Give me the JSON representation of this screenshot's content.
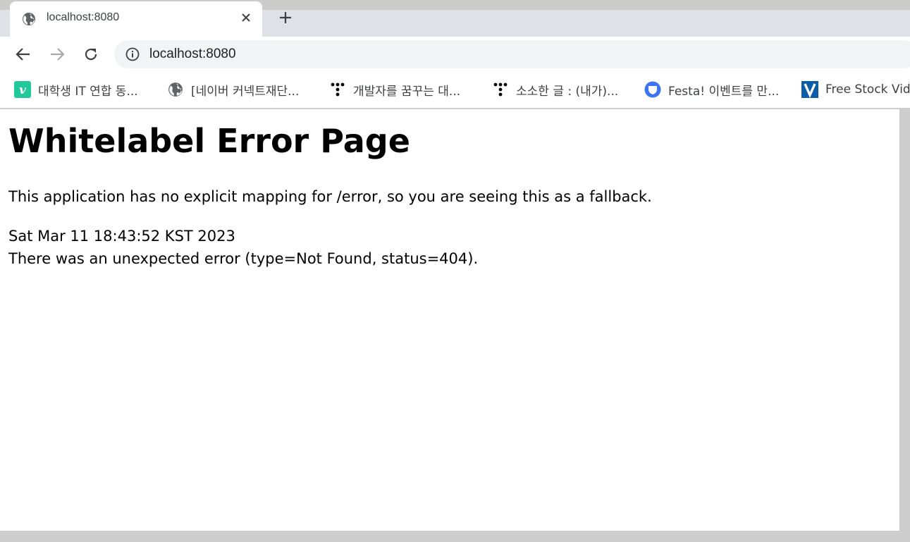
{
  "browser": {
    "tab": {
      "title": "localhost:8080",
      "close_glyph": "✕"
    },
    "new_tab_glyph": "+",
    "address_bar": {
      "value": "localhost:8080"
    },
    "bookmarks": [
      {
        "label": "대학생 IT 연합 동...",
        "icon": "v-letter-icon",
        "icon_text": "v",
        "icon_color": "#20c997"
      },
      {
        "label": "[네이버 커넥트재단...",
        "icon": "globe-icon"
      },
      {
        "label": "개발자를 꿈꾸는 대...",
        "icon": "tistory-dots-icon"
      },
      {
        "label": "소소한 글 : (내가)...",
        "icon": "tistory-dots-icon"
      },
      {
        "label": "Festa! 이벤트를 만...",
        "icon": "festa-shield-icon",
        "icon_color": "#3b73f5"
      },
      {
        "label": "Free Stock Video",
        "icon": "v-square-icon",
        "icon_text": "V",
        "icon_color": "#0a5ea8"
      }
    ]
  },
  "page": {
    "heading": "Whitelabel Error Page",
    "message": "This application has no explicit mapping for /error, so you are seeing this as a fallback.",
    "timestamp": "Sat Mar 11 18:43:52 KST 2023",
    "error": "There was an unexpected error (type=Not Found, status=404)."
  }
}
